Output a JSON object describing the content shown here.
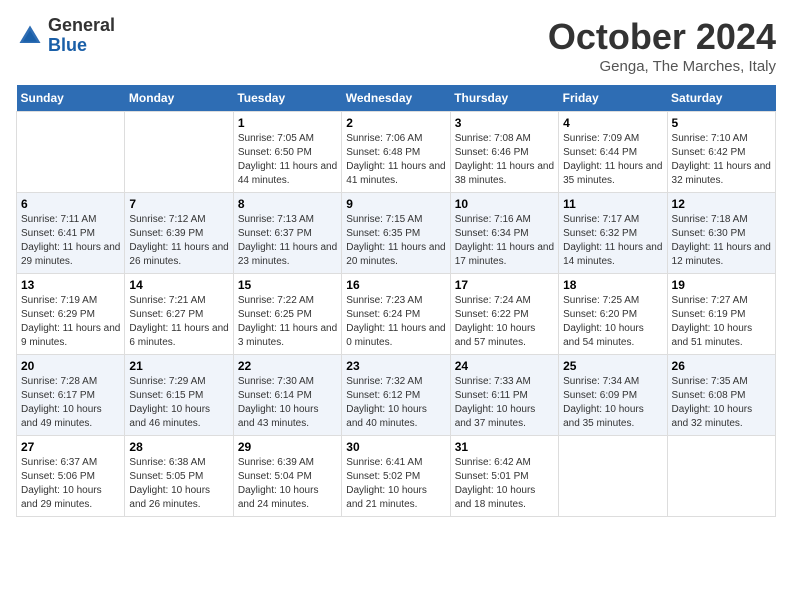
{
  "header": {
    "logo_general": "General",
    "logo_blue": "Blue",
    "month_title": "October 2024",
    "location": "Genga, The Marches, Italy"
  },
  "days_of_week": [
    "Sunday",
    "Monday",
    "Tuesday",
    "Wednesday",
    "Thursday",
    "Friday",
    "Saturday"
  ],
  "weeks": [
    [
      {
        "day": "",
        "info": ""
      },
      {
        "day": "",
        "info": ""
      },
      {
        "day": "1",
        "info": "Sunrise: 7:05 AM\nSunset: 6:50 PM\nDaylight: 11 hours and 44 minutes."
      },
      {
        "day": "2",
        "info": "Sunrise: 7:06 AM\nSunset: 6:48 PM\nDaylight: 11 hours and 41 minutes."
      },
      {
        "day": "3",
        "info": "Sunrise: 7:08 AM\nSunset: 6:46 PM\nDaylight: 11 hours and 38 minutes."
      },
      {
        "day": "4",
        "info": "Sunrise: 7:09 AM\nSunset: 6:44 PM\nDaylight: 11 hours and 35 minutes."
      },
      {
        "day": "5",
        "info": "Sunrise: 7:10 AM\nSunset: 6:42 PM\nDaylight: 11 hours and 32 minutes."
      }
    ],
    [
      {
        "day": "6",
        "info": "Sunrise: 7:11 AM\nSunset: 6:41 PM\nDaylight: 11 hours and 29 minutes."
      },
      {
        "day": "7",
        "info": "Sunrise: 7:12 AM\nSunset: 6:39 PM\nDaylight: 11 hours and 26 minutes."
      },
      {
        "day": "8",
        "info": "Sunrise: 7:13 AM\nSunset: 6:37 PM\nDaylight: 11 hours and 23 minutes."
      },
      {
        "day": "9",
        "info": "Sunrise: 7:15 AM\nSunset: 6:35 PM\nDaylight: 11 hours and 20 minutes."
      },
      {
        "day": "10",
        "info": "Sunrise: 7:16 AM\nSunset: 6:34 PM\nDaylight: 11 hours and 17 minutes."
      },
      {
        "day": "11",
        "info": "Sunrise: 7:17 AM\nSunset: 6:32 PM\nDaylight: 11 hours and 14 minutes."
      },
      {
        "day": "12",
        "info": "Sunrise: 7:18 AM\nSunset: 6:30 PM\nDaylight: 11 hours and 12 minutes."
      }
    ],
    [
      {
        "day": "13",
        "info": "Sunrise: 7:19 AM\nSunset: 6:29 PM\nDaylight: 11 hours and 9 minutes."
      },
      {
        "day": "14",
        "info": "Sunrise: 7:21 AM\nSunset: 6:27 PM\nDaylight: 11 hours and 6 minutes."
      },
      {
        "day": "15",
        "info": "Sunrise: 7:22 AM\nSunset: 6:25 PM\nDaylight: 11 hours and 3 minutes."
      },
      {
        "day": "16",
        "info": "Sunrise: 7:23 AM\nSunset: 6:24 PM\nDaylight: 11 hours and 0 minutes."
      },
      {
        "day": "17",
        "info": "Sunrise: 7:24 AM\nSunset: 6:22 PM\nDaylight: 10 hours and 57 minutes."
      },
      {
        "day": "18",
        "info": "Sunrise: 7:25 AM\nSunset: 6:20 PM\nDaylight: 10 hours and 54 minutes."
      },
      {
        "day": "19",
        "info": "Sunrise: 7:27 AM\nSunset: 6:19 PM\nDaylight: 10 hours and 51 minutes."
      }
    ],
    [
      {
        "day": "20",
        "info": "Sunrise: 7:28 AM\nSunset: 6:17 PM\nDaylight: 10 hours and 49 minutes."
      },
      {
        "day": "21",
        "info": "Sunrise: 7:29 AM\nSunset: 6:15 PM\nDaylight: 10 hours and 46 minutes."
      },
      {
        "day": "22",
        "info": "Sunrise: 7:30 AM\nSunset: 6:14 PM\nDaylight: 10 hours and 43 minutes."
      },
      {
        "day": "23",
        "info": "Sunrise: 7:32 AM\nSunset: 6:12 PM\nDaylight: 10 hours and 40 minutes."
      },
      {
        "day": "24",
        "info": "Sunrise: 7:33 AM\nSunset: 6:11 PM\nDaylight: 10 hours and 37 minutes."
      },
      {
        "day": "25",
        "info": "Sunrise: 7:34 AM\nSunset: 6:09 PM\nDaylight: 10 hours and 35 minutes."
      },
      {
        "day": "26",
        "info": "Sunrise: 7:35 AM\nSunset: 6:08 PM\nDaylight: 10 hours and 32 minutes."
      }
    ],
    [
      {
        "day": "27",
        "info": "Sunrise: 6:37 AM\nSunset: 5:06 PM\nDaylight: 10 hours and 29 minutes."
      },
      {
        "day": "28",
        "info": "Sunrise: 6:38 AM\nSunset: 5:05 PM\nDaylight: 10 hours and 26 minutes."
      },
      {
        "day": "29",
        "info": "Sunrise: 6:39 AM\nSunset: 5:04 PM\nDaylight: 10 hours and 24 minutes."
      },
      {
        "day": "30",
        "info": "Sunrise: 6:41 AM\nSunset: 5:02 PM\nDaylight: 10 hours and 21 minutes."
      },
      {
        "day": "31",
        "info": "Sunrise: 6:42 AM\nSunset: 5:01 PM\nDaylight: 10 hours and 18 minutes."
      },
      {
        "day": "",
        "info": ""
      },
      {
        "day": "",
        "info": ""
      }
    ]
  ]
}
